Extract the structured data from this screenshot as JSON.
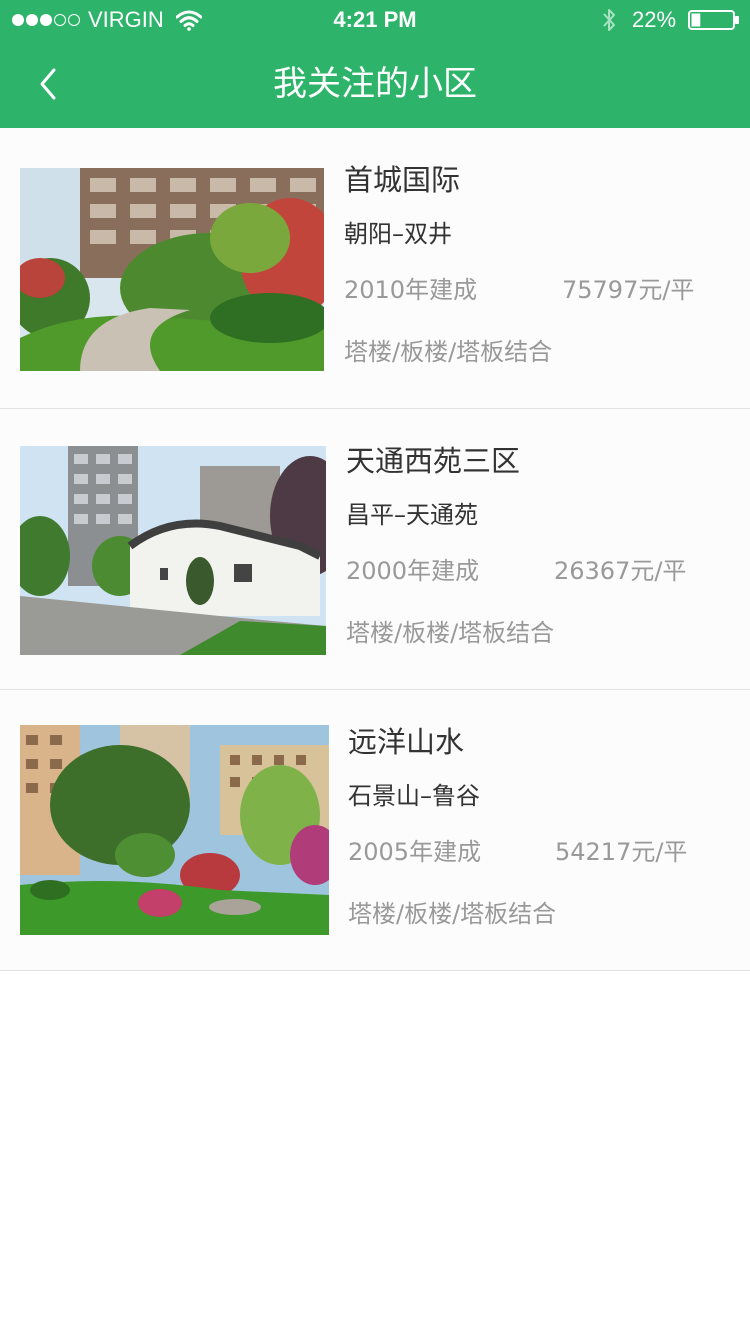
{
  "status_bar": {
    "carrier": "VIRGIN",
    "time": "4:21 PM",
    "battery": "22%",
    "signal_strength": 3,
    "signal_max": 5,
    "battery_level": 0.22
  },
  "nav": {
    "title": "我关注的小区",
    "back_icon": "chevron-left-icon"
  },
  "theme": {
    "header_color": "#2db46a",
    "text_primary": "#333333",
    "text_secondary": "#999999"
  },
  "communities": [
    {
      "name": "首城国际",
      "location": "朝阳–双井",
      "built_year": "2010年建成",
      "price": "75797元/平",
      "building_types": "塔楼/板楼/塔板结合"
    },
    {
      "name": "天通西苑三区",
      "location": "昌平–天通苑",
      "built_year": "2000年建成",
      "price": "26367元/平",
      "building_types": "塔楼/板楼/塔板结合"
    },
    {
      "name": "远洋山水",
      "location": "石景山–鲁谷",
      "built_year": "2005年建成",
      "price": "54217元/平",
      "building_types": "塔楼/板楼/塔板结合"
    }
  ]
}
